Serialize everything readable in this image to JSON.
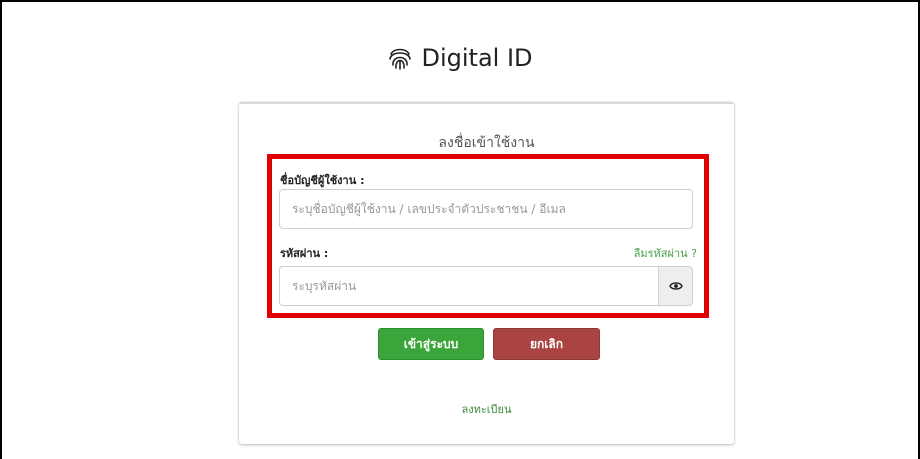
{
  "brand": {
    "title": "Digital ID",
    "logo_icon": "fingerprint-icon"
  },
  "login_card": {
    "title": "ลงชื่อเข้าใช้งาน",
    "username": {
      "label": "ชื่อบัญชีผู้ใช้งาน :",
      "placeholder": "ระบุชื่อบัญชีผู้ใช้งาน / เลขประจำตัวประชาชน / อีเมล",
      "value": ""
    },
    "password": {
      "label": "รหัสผ่าน :",
      "placeholder": "ระบุรหัสผ่าน",
      "value": "",
      "toggle_icon": "eye-icon"
    },
    "forgot_password": "ลืมรหัสผ่าน ?",
    "login_button": "เข้าสู่ระบบ",
    "cancel_button": "ยกเลิก",
    "register_link": "ลงทะเบียน"
  },
  "colors": {
    "highlight_border": "#e00000",
    "login_button": "#3aa53a",
    "cancel_button": "#a94442",
    "link_green": "#4aa14a"
  }
}
